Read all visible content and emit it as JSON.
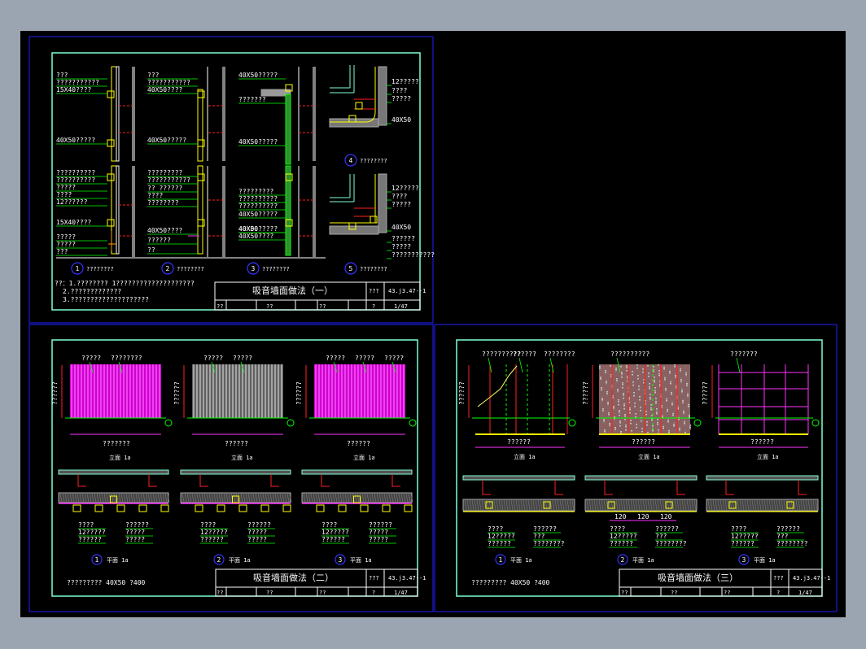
{
  "colors": {
    "bg": "#9aa5b1",
    "canvas": "#000000",
    "frame": "#2020ff",
    "border": "#7fffd4",
    "text": "#ffffff",
    "yellow": "#ffff00",
    "magenta": "#ff33ff",
    "green": "#00ff00",
    "red": "#ff2020",
    "gray": "#9a9a9a"
  },
  "sheets": [
    {
      "title": "吸音墙面做法（一）",
      "code": "43.j3.47--1",
      "no": "1/47",
      "fields": [
        "??",
        "??",
        "??",
        "??",
        "??",
        "?"
      ],
      "field_right": "???",
      "details": [
        {
          "num": "1",
          "label": "????????"
        },
        {
          "num": "2",
          "label": "????????"
        },
        {
          "num": "3",
          "label": "????????"
        },
        {
          "num": "4",
          "label": "????????"
        },
        {
          "num": "5",
          "label": "????????"
        }
      ],
      "notes": [
        "??：1.????????  1????????????????????",
        "2.?????????????",
        "3.????????????????????"
      ],
      "leaders_a": [
        "???",
        "???????????",
        "15X40????",
        "40X50?????",
        "??????????",
        "??????????",
        "?????",
        "????",
        "12??????",
        "15X40????",
        "?????",
        "?????",
        "???"
      ],
      "leaders_b": [
        "???",
        "???????????",
        "40X50????",
        "40X50?????",
        "?????????",
        "???????????",
        "?? ??????",
        "????",
        "????????",
        "40X50????",
        "??????",
        "??"
      ],
      "leaders_c": [
        "40X50?????",
        "???????",
        "40X50?????",
        "?????????",
        "??????????",
        "??????????",
        "40X50?????",
        "40X50?????",
        "40X50????",
        "40X00"
      ],
      "leaders_d": [
        "12?????",
        "????",
        "?????",
        "40X50",
        "12?????",
        "????",
        "?????",
        "40X50",
        "??????",
        "?????",
        "???????????"
      ]
    },
    {
      "title": "吸音墙面做法（二）",
      "code": "43.j3.47--1",
      "no": "1/47",
      "fields": [
        "??",
        "??",
        "??",
        "??",
        "??",
        "?"
      ],
      "field_right": "???",
      "note": "?????????   40X50   ?400",
      "plan_label": "平面 1a",
      "section_label": "立面 1a",
      "dim_h": "??????",
      "top_labels": [
        [
          "?????",
          "????????"
        ],
        [
          "?????",
          "?????"
        ],
        [
          "?????",
          "?????",
          "?????"
        ]
      ],
      "elev_labels": [
        "???????",
        "??????",
        "??????"
      ],
      "sec_labels": [
        "????",
        "12?????",
        "??????",
        "??????",
        "?????",
        "?????"
      ]
    },
    {
      "title": "吸音墙面做法（三）",
      "code": "43.j3.47--1",
      "no": "1/47",
      "fields": [
        "??",
        "??",
        "??",
        "??",
        "??",
        "?"
      ],
      "field_right": "???",
      "note": "?????????   40X50   ?400",
      "plan_label": "平面 1a",
      "section_label": "立面 1a",
      "dim_h": "??????",
      "top_labels": [
        [
          "??????????",
          "??????",
          "????????"
        ],
        [
          "??????????"
        ],
        [
          "???????"
        ]
      ],
      "elev_labels": [
        "??????",
        "??????",
        "??????"
      ],
      "dims": [
        "120",
        "120",
        "120"
      ],
      "sec_labels": [
        "????",
        "12?????",
        "??????",
        "??????",
        "???",
        "????????"
      ]
    }
  ]
}
